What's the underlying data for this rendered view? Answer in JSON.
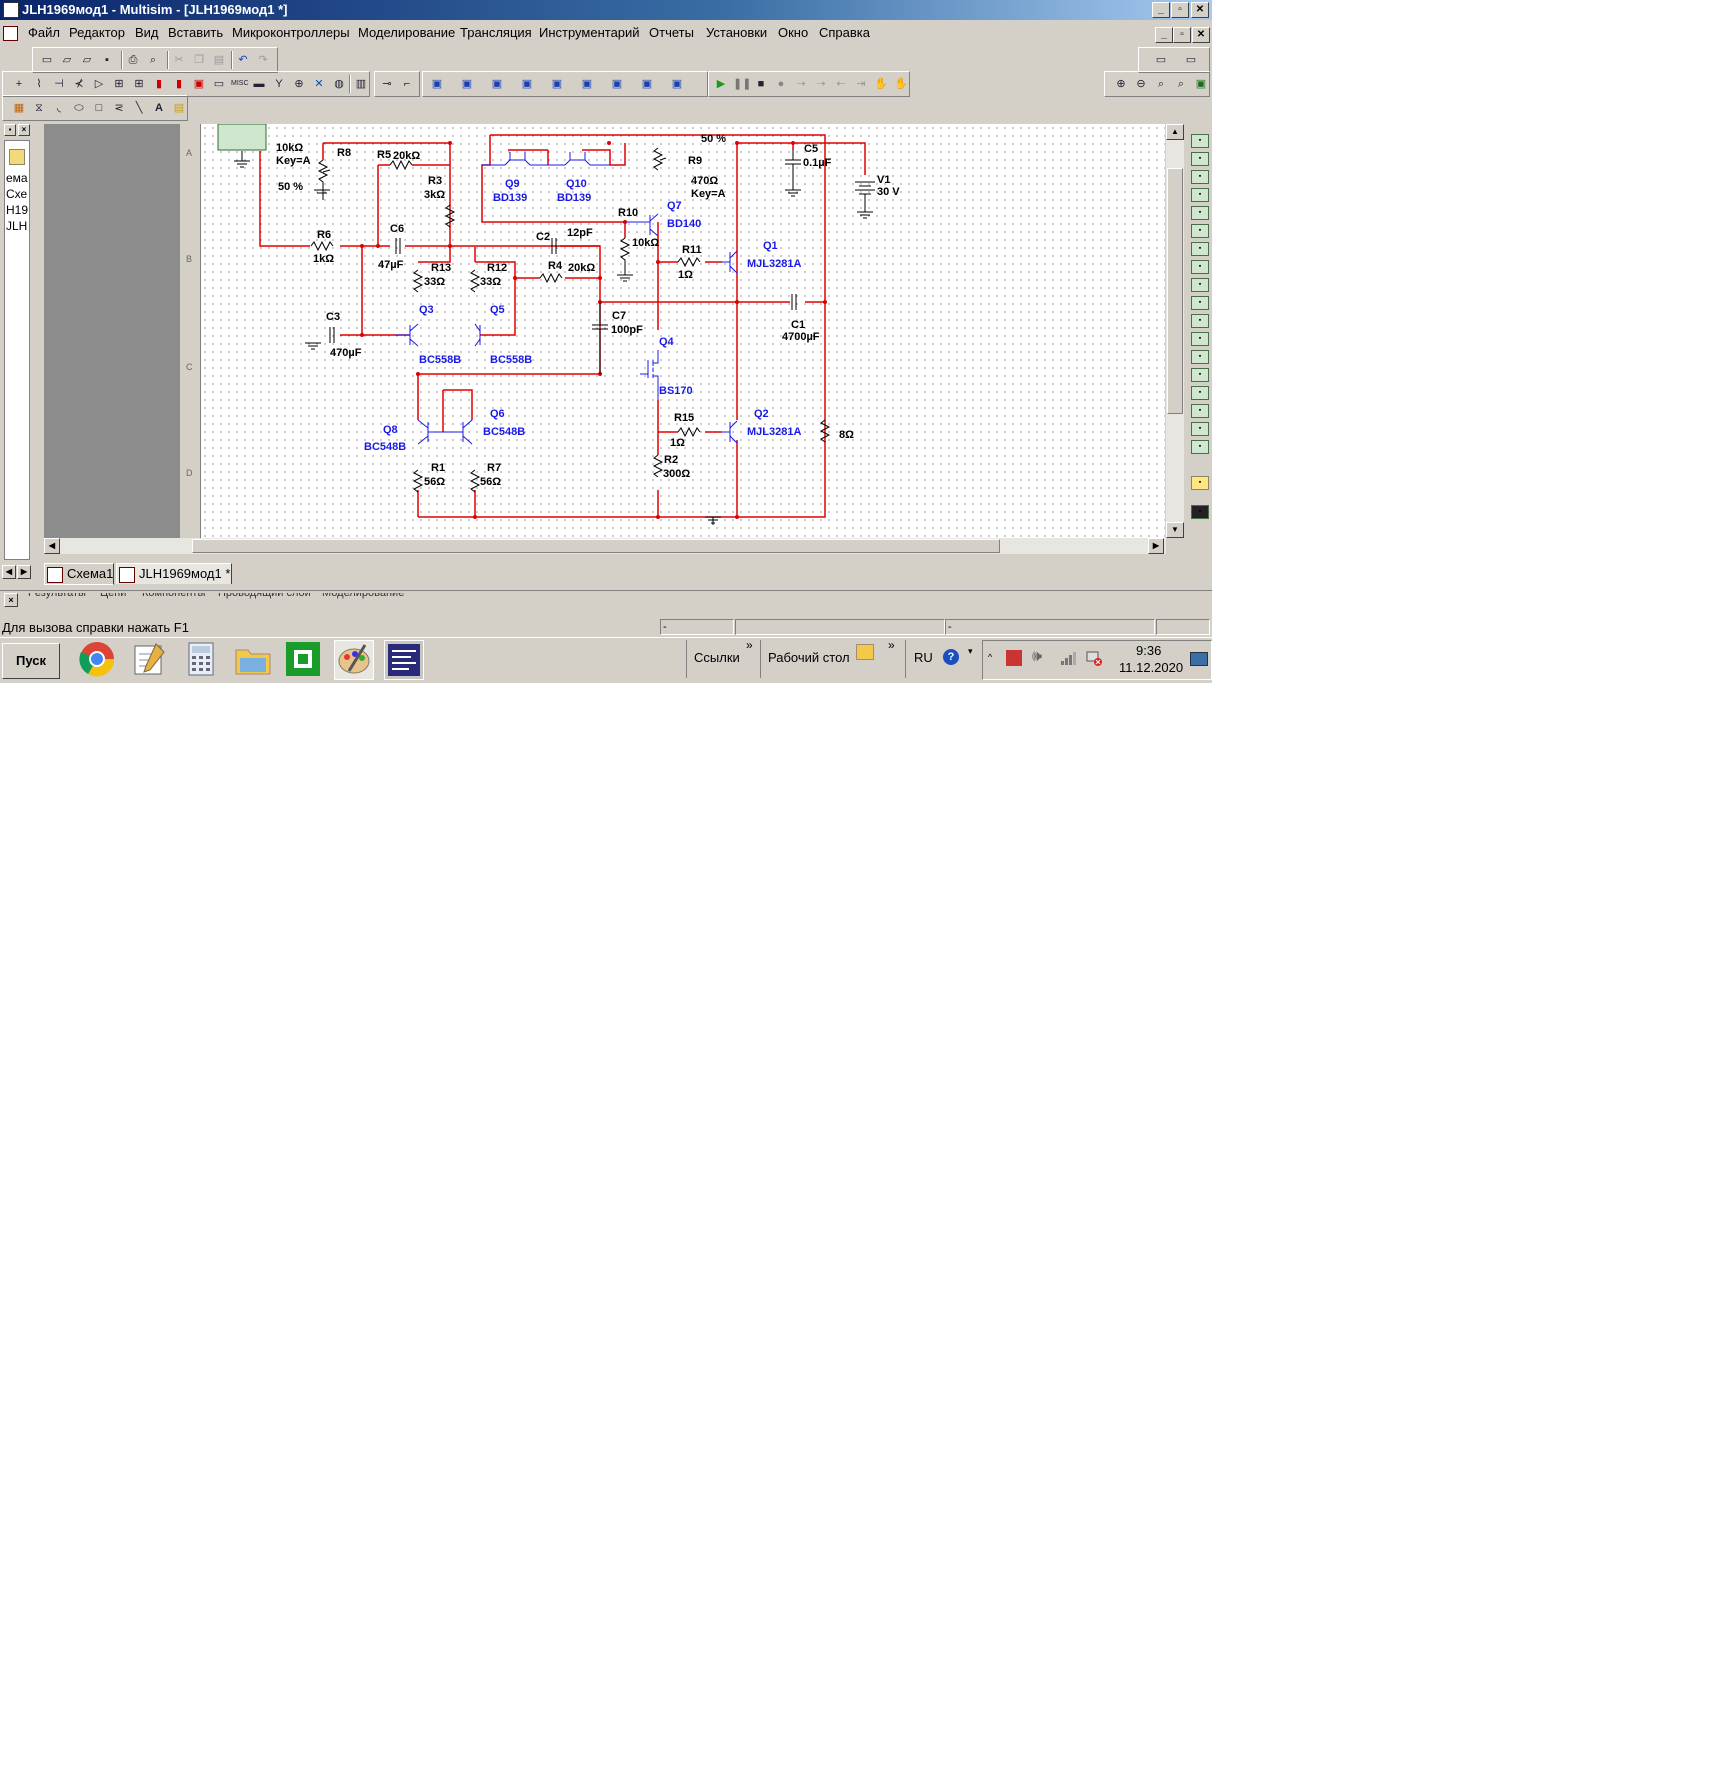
{
  "window": {
    "title": "JLH1969мод1 - Multisim - [JLH1969мод1 *]",
    "min": "_",
    "max": "▫",
    "close": "✕"
  },
  "menu": [
    "Файл",
    "Редактор",
    "Вид",
    "Вставить",
    "Микроконтроллеры",
    "Моделирование",
    "Трансляция",
    "Инструментарий",
    "Отчеты",
    "Установки",
    "Окно",
    "Справка"
  ],
  "left_panel": [
    "ема",
    "Схе",
    "Н19",
    "JLH"
  ],
  "schematic": {
    "components": {
      "r8": {
        "ref": "R8",
        "value": "10kΩ",
        "key": "Key=A",
        "pct": "50 %"
      },
      "r5": {
        "ref": "R5",
        "value": "20kΩ"
      },
      "r3": {
        "ref": "R3",
        "value": "3kΩ"
      },
      "q9": {
        "ref": "Q9",
        "model": "BD139"
      },
      "q10": {
        "ref": "Q10",
        "model": "BD139"
      },
      "r9": {
        "ref": "R9",
        "value": "470Ω",
        "key": "Key=A",
        "pct": "50 %"
      },
      "c5": {
        "ref": "C5",
        "value": "0.1µF"
      },
      "v1": {
        "ref": "V1",
        "value": "30 V"
      },
      "r10": {
        "ref": "R10",
        "value": "10kΩ"
      },
      "q7": {
        "ref": "Q7",
        "model": "BD140"
      },
      "q1": {
        "ref": "Q1",
        "model": "MJL3281A"
      },
      "r6": {
        "ref": "R6",
        "value": "1kΩ"
      },
      "c6": {
        "ref": "C6",
        "value": "47µF"
      },
      "c2": {
        "ref": "C2",
        "value": "12pF"
      },
      "r11": {
        "ref": "R11",
        "value": "1Ω"
      },
      "r13": {
        "ref": "R13",
        "value": "33Ω"
      },
      "r12": {
        "ref": "R12",
        "value": "33Ω"
      },
      "r4": {
        "ref": "R4",
        "value": "20kΩ"
      },
      "c1": {
        "ref": "C1",
        "value": "4700µF"
      },
      "c3": {
        "ref": "C3",
        "value": "470µF"
      },
      "q3": {
        "ref": "Q3",
        "model": "BC558B"
      },
      "q5": {
        "ref": "Q5",
        "model": "BC558B"
      },
      "c7": {
        "ref": "C7",
        "value": "100pF"
      },
      "q4": {
        "ref": "Q4",
        "model": "BS170"
      },
      "q8": {
        "ref": "Q8",
        "model": "BC548B"
      },
      "q6": {
        "ref": "Q6",
        "model": "BC548B"
      },
      "r15": {
        "ref": "R15",
        "value": "1Ω"
      },
      "q2": {
        "ref": "Q2",
        "model": "MJL3281A"
      },
      "rl": {
        "value": "8Ω"
      },
      "r1": {
        "ref": "R1",
        "value": "56Ω"
      },
      "r7": {
        "ref": "R7",
        "value": "56Ω"
      },
      "r2": {
        "ref": "R2",
        "value": "300Ω"
      }
    },
    "ruler": [
      "A",
      "B",
      "C",
      "D"
    ],
    "colors": {
      "wire": "#e00000",
      "component": "#1a1ae6",
      "sheet": "#ffffff",
      "canvas_gray": "#8c8c8c"
    }
  },
  "tabs": [
    {
      "label": "Схема1"
    },
    {
      "label": "JLH1969мод1 *"
    }
  ],
  "bottom_tabs": [
    "Результаты",
    "Цепи",
    "Компоненты",
    "Проводящий слой",
    "Моделирование"
  ],
  "status": {
    "help": "Для вызова справки нажать F1",
    "cell1": "-",
    "cell2": "-"
  },
  "taskbar": {
    "start": "Пуск",
    "links": "Ссылки",
    "desktop": "Рабочий стол",
    "lang": "RU",
    "time": "9:36",
    "date": "11.12.2020",
    "chevron": "»"
  }
}
